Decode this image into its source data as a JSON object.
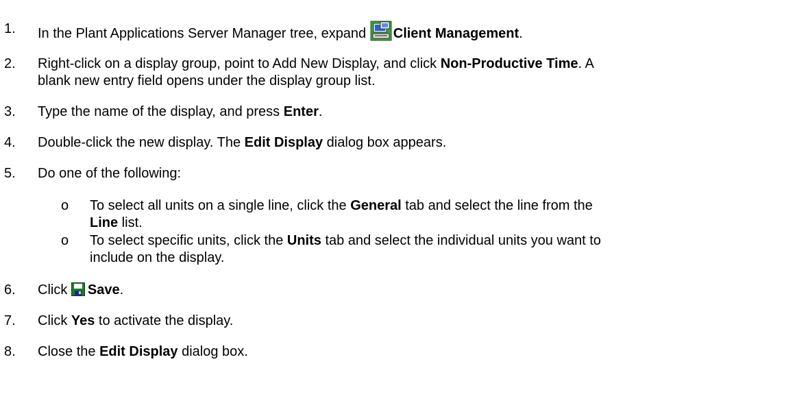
{
  "steps": [
    {
      "num": "1.",
      "lines": [
        [
          {
            "t": "In the Plant Applications Server Manager tree, expand ",
            "b": false
          },
          {
            "icon": "client-management-icon"
          },
          {
            "t": "Client Management",
            "b": true
          },
          {
            "t": ".",
            "b": false
          }
        ]
      ]
    },
    {
      "num": "2.",
      "lines": [
        [
          {
            "t": "Right-click on a display group, point to Add New Display, and click ",
            "b": false
          },
          {
            "t": "Non-Productive Time",
            "b": true
          },
          {
            "t": ". A",
            "b": false
          }
        ],
        [
          {
            "t": "blank new entry field opens under the display group list.",
            "b": false
          }
        ]
      ]
    },
    {
      "num": "3.",
      "lines": [
        [
          {
            "t": "Type the name of the display, and press ",
            "b": false
          },
          {
            "t": "Enter",
            "b": true
          },
          {
            "t": ".",
            "b": false
          }
        ]
      ]
    },
    {
      "num": "4.",
      "lines": [
        [
          {
            "t": "Double-click the new display. The ",
            "b": false
          },
          {
            "t": "Edit Display",
            "b": true
          },
          {
            "t": " dialog box appears.",
            "b": false
          }
        ]
      ]
    },
    {
      "num": "5.",
      "lines": [
        [
          {
            "t": "Do one of the following:",
            "b": false
          }
        ]
      ]
    },
    {
      "num": "6.",
      "lines": [
        [
          {
            "t": "Click ",
            "b": false
          },
          {
            "icon": "save-icon"
          },
          {
            "t": "Save",
            "b": true
          },
          {
            "t": ".",
            "b": false
          }
        ]
      ]
    },
    {
      "num": "7.",
      "lines": [
        [
          {
            "t": "Click ",
            "b": false
          },
          {
            "t": "Yes",
            "b": true
          },
          {
            "t": " to activate the display.",
            "b": false
          }
        ]
      ]
    },
    {
      "num": "8.",
      "lines": [
        [
          {
            "t": "Close the ",
            "b": false
          },
          {
            "t": "Edit Display",
            "b": true
          },
          {
            "t": " dialog box.",
            "b": false
          }
        ]
      ]
    }
  ],
  "subitems": [
    {
      "bullet": "o",
      "lines": [
        [
          {
            "t": "To select all units on a single line, click the ",
            "b": false
          },
          {
            "t": "General",
            "b": true
          },
          {
            "t": " tab and select the line from the",
            "b": false
          }
        ],
        [
          {
            "t": "Line",
            "b": true
          },
          {
            "t": " list.",
            "b": false
          }
        ]
      ]
    },
    {
      "bullet": "o",
      "lines": [
        [
          {
            "t": "To select specific units, click the ",
            "b": false
          },
          {
            "t": "Units",
            "b": true
          },
          {
            "t": " tab and select the individual units you want to",
            "b": false
          }
        ],
        [
          {
            "t": "include on the display.",
            "b": false
          }
        ]
      ]
    }
  ],
  "colors": {
    "text": "#000000",
    "background": "#ffffff"
  }
}
